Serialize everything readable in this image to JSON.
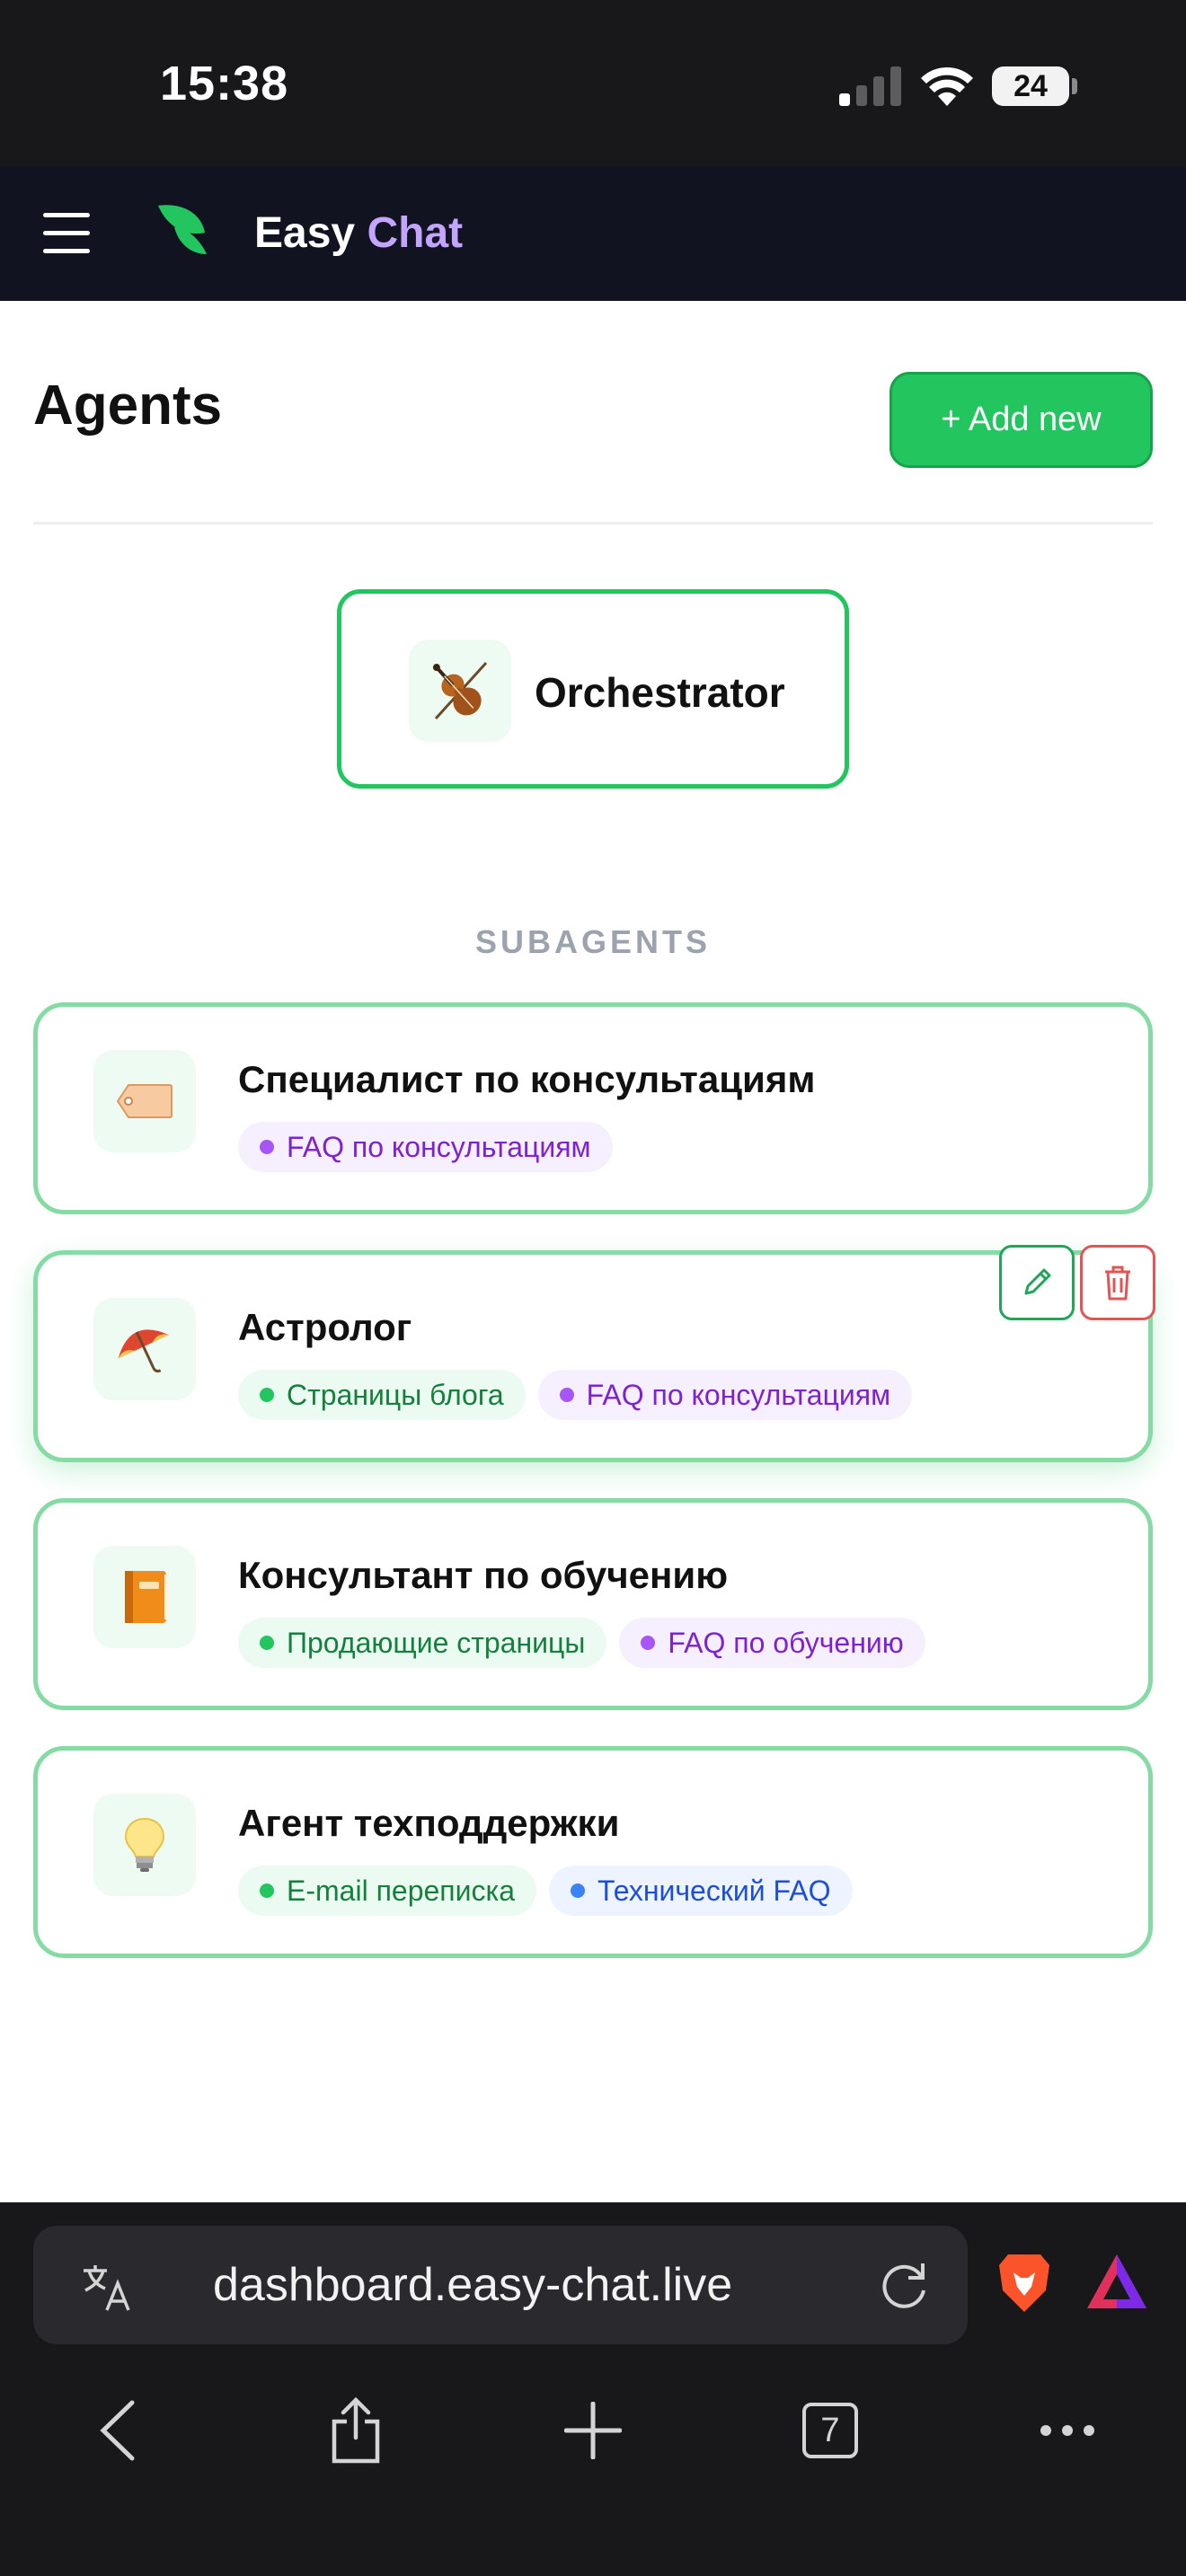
{
  "status_bar": {
    "time": "15:38",
    "battery": "24"
  },
  "header": {
    "brand_first": "Easy",
    "brand_second": "Chat"
  },
  "page": {
    "title": "Agents",
    "add_button": "+ Add new"
  },
  "orchestrator": {
    "name": "Orchestrator",
    "icon": "violin-icon"
  },
  "subagents_label": "SUBAGENTS",
  "agents": [
    {
      "name": "Специалист по консультациям",
      "icon": "label-tag-icon",
      "tags": [
        {
          "label": "FAQ по консультациям",
          "color": "purple"
        }
      ]
    },
    {
      "name": "Астролог",
      "icon": "umbrella-icon",
      "tags": [
        {
          "label": "Страницы блога",
          "color": "green"
        },
        {
          "label": "FAQ по консультациям",
          "color": "purple"
        }
      ]
    },
    {
      "name": "Консультант по обучению",
      "icon": "notebook-icon",
      "tags": [
        {
          "label": "Продающие страницы",
          "color": "green"
        },
        {
          "label": "FAQ по обучению",
          "color": "purple"
        }
      ]
    },
    {
      "name": "Агент техподдержки",
      "icon": "lightbulb-icon",
      "tags": [
        {
          "label": "E-mail переписка",
          "color": "green"
        },
        {
          "label": "Технический FAQ",
          "color": "blue"
        }
      ]
    }
  ],
  "colors": {
    "accent": "#22c55e",
    "header_bg": "#111320",
    "brand_accent": "#c3a4ff"
  },
  "browser": {
    "url": "dashboard.easy-chat.live",
    "tabs_count": "7"
  }
}
